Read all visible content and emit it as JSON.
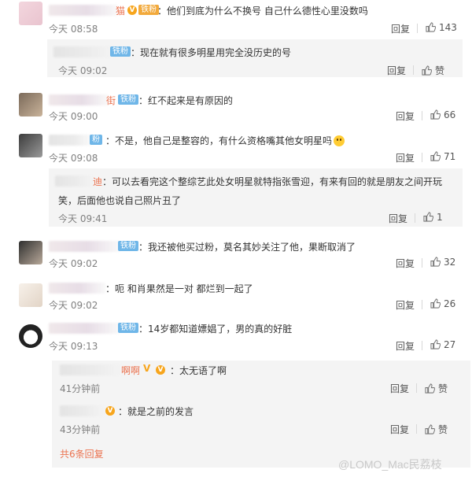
{
  "comments": [
    {
      "text": "：他们到底为什么不换号 自己什么德性心里没数吗",
      "time": "今天 08:58",
      "reply": "回复",
      "likes": "143",
      "badge": "铁粉",
      "name_tail": "猫"
    },
    {
      "text": "：现在就有很多明星用完全没历史的号",
      "time": "今天 09:02",
      "reply": "回复",
      "likes": "赞",
      "badge": "铁粉"
    },
    {
      "text": "：红不起来是有原因的",
      "time": "今天 09:00",
      "reply": "回复",
      "likes": "66",
      "badge": "铁粉",
      "name_tail": "街"
    },
    {
      "text": "：不是，他自己是整容的，有什么资格嘴其他女明星吗",
      "time": "今天 09:08",
      "reply": "回复",
      "likes": "71",
      "badge": "粉"
    },
    {
      "text_line1": "：可以去看完这个整综艺此处女明星就特指张雪迎，有来有回的就是朋友之间开玩",
      "text_line2": "笑，后面他也说自己照片丑了",
      "time": "今天 09:41",
      "reply": "回复",
      "likes": "1",
      "name_tail": "迪"
    },
    {
      "text": "：我还被他买过粉，莫名其妙关注了他，果断取消了",
      "time": "今天 09:02",
      "reply": "回复",
      "likes": "32",
      "badge": "铁粉"
    },
    {
      "text": "：呃 和肖果然是一对 都烂到一起了",
      "time": "今天 09:02",
      "reply": "回复",
      "likes": "26"
    },
    {
      "text": "：14岁都知道嫖娼了，男的真的好脏",
      "time": "今天 09:13",
      "reply": "回复",
      "likes": "27",
      "badge": "铁粉"
    }
  ],
  "sub_replies": [
    {
      "name_tail": "啊啊",
      "text": "：太无语了啊",
      "time": "41分钟前",
      "reply": "回复",
      "likes": "赞"
    },
    {
      "text": "：就是之前的发言",
      "time": "43分钟前",
      "reply": "回复",
      "likes": "赞"
    }
  ],
  "more_replies": "共6条回复",
  "watermark": "@LOMO_Mac民荔枝",
  "colors": {
    "accent": "#eb7350",
    "badge": "#6fb6e8",
    "reply_bg": "#f4f4f4"
  }
}
